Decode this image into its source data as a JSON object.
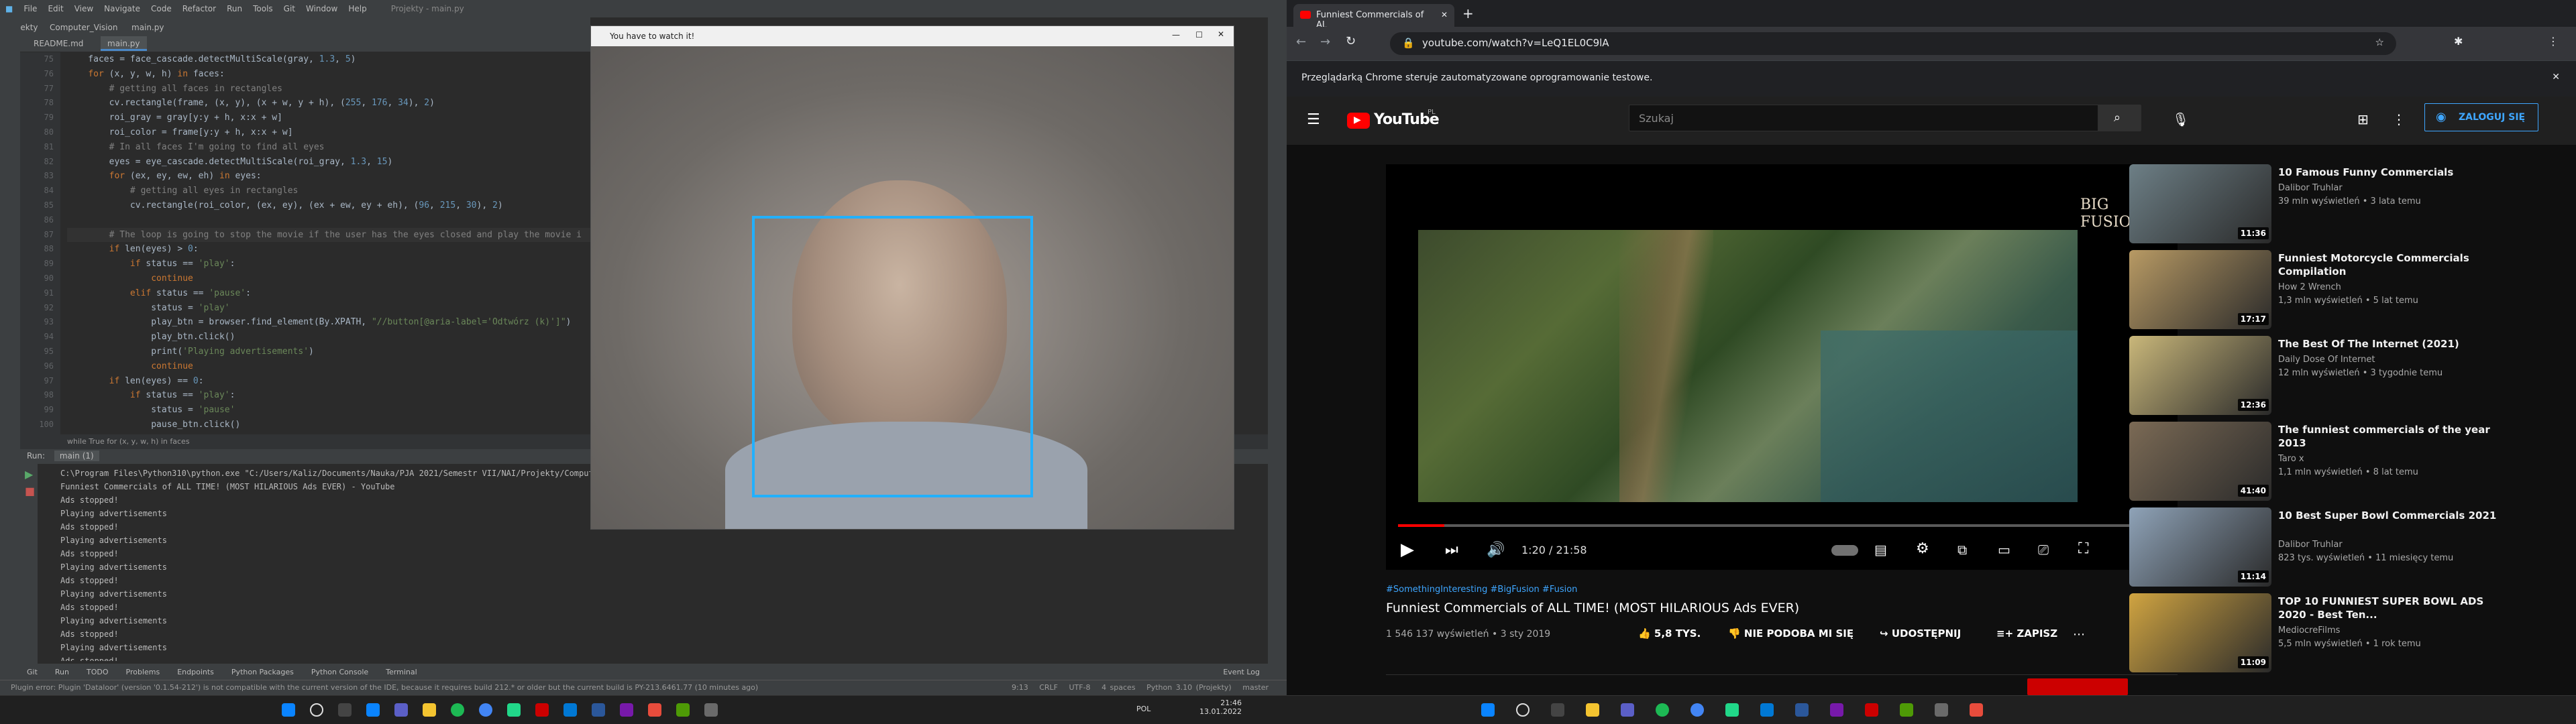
{
  "ide": {
    "menu": [
      "File",
      "Edit",
      "View",
      "Navigate",
      "Code",
      "Refactor",
      "Run",
      "Tools",
      "Git",
      "Window",
      "Help"
    ],
    "window_title": "Projekty - main.py",
    "breadcrumb": [
      "Projekty",
      "Computer_Vision",
      "main.py"
    ],
    "file_tabs": [
      "README.md",
      "main.py"
    ],
    "code_lines": [
      "    faces = face_cascade.detectMultiScale(gray, 1.3, 5)",
      "    for (x, y, w, h) in faces:",
      "        # getting all faces in rectangles",
      "        cv.rectangle(frame, (x, y), (x + w, y + h), (255, 176, 34), 2)",
      "        roi_gray = gray[y:y + h, x:x + w]",
      "        roi_color = frame[y:y + h, x:x + w]",
      "        # In all faces I'm going to find all eyes",
      "        eyes = eye_cascade.detectMultiScale(roi_gray, 1.3, 15)",
      "        for (ex, ey, ew, eh) in eyes:",
      "            # getting all eyes in rectangles",
      "            cv.rectangle(roi_color, (ex, ey), (ex + ew, ey + eh), (96, 215, 30), 2)",
      "",
      "        # The loop is going to stop the movie if the user has the eyes closed and play the movie i",
      "        if len(eyes) > 0:",
      "            if status == 'play':",
      "                continue",
      "            elif status == 'pause':",
      "                status = 'play'",
      "                play_btn = browser.find_element(By.XPATH, \"//button[@aria-label='Odtwórz (k)']\")",
      "                play_btn.click()",
      "                print('Playing advertisements')",
      "                continue",
      "        if len(eyes) == 0:",
      "            if status == 'play':",
      "                status = 'pause'",
      "                pause_btn.click()"
    ],
    "code_crumb": "while True    for (x, y, w, h) in faces",
    "run_tab": "Run:",
    "run_name": "main (1)",
    "run_output": [
      "C:\\Program Files\\Python310\\python.exe \"C:/Users/Kaliz/Documents/Nauka/PJA 2021/Semestr VII/NAI/Projekty/Computer",
      "Funniest Commercials of ALL TIME! (MOST HILARIOUS Ads EVER) - YouTube",
      "Ads stopped!",
      "Playing advertisements",
      "Ads stopped!",
      "Playing advertisements",
      "Ads stopped!",
      "Playing advertisements",
      "Ads stopped!",
      "Playing advertisements",
      "Ads stopped!",
      "Playing advertisements",
      "Ads stopped!",
      "Playing advertisements",
      "Ads stopped!"
    ],
    "bottom_tabs": [
      "Git",
      "Run",
      "TODO",
      "Problems",
      "Endpoints",
      "Python Packages",
      "Python Console",
      "Terminal"
    ],
    "event_log": "Event Log",
    "status_msg": "Plugin error: Plugin 'Dataloor' (version '0.1.54-212') is not compatible with the current version of the IDE, because it requires build 212.* or older but the current build is PY-213.6461.77 (10 minutes ago)",
    "status_right": [
      "9:13",
      "CRLF",
      "UTF-8",
      "4 spaces",
      "Python 3.10 (Projekty)",
      "master"
    ]
  },
  "camera": {
    "title": "You have to watch it!"
  },
  "chrome": {
    "tab_title": "Funniest Commercials of AL",
    "url": "youtube.com/watch?v=LeQ1EL0C9lA",
    "infobar": "Przeglądarką Chrome steruje zautomatyzowane oprogramowanie testowe."
  },
  "youtube": {
    "logo": "YouTube",
    "region": "PL",
    "search_placeholder": "Szukaj",
    "signin": "ZALOGUJ SIĘ",
    "video_brand": "BIG FUSION",
    "time": "1:20 / 21:58",
    "progress": 0.06,
    "hashtags": "#SomethingInteresting #BigFusion #Fusion",
    "title": "Funniest Commercials of ALL TIME! (MOST HILARIOUS Ads EVER)",
    "meta": "1 546 137 wyświetleń • 3 sty 2019",
    "likes": "5,8 TYS.",
    "dislike": "NIE PODOBA MI SIĘ",
    "share": "UDOSTĘPNIJ",
    "save": "ZAPISZ",
    "suggestions": [
      {
        "title": "10 Famous Funny Commercials",
        "channel": "Dalibor Truhlar",
        "meta": "39 mln wyświetleń • 3 lata temu",
        "duration": "11:36",
        "color": "#6d7f86"
      },
      {
        "title": "Funniest Motorcycle Commercials Compilation",
        "channel": "How 2 Wrench",
        "meta": "1,3 mln wyświetleń • 5 lat temu",
        "duration": "17:17",
        "color": "#b89a64"
      },
      {
        "title": "The Best Of The Internet (2021)",
        "channel": "Daily Dose Of Internet",
        "meta": "12 mln wyświetleń • 3 tygodnie temu",
        "duration": "12:36",
        "color": "#c9b77a"
      },
      {
        "title": "The funniest commercials of the year 2013",
        "channel": "Taro x",
        "meta": "1,1 mln wyświetleń • 8 lat temu",
        "duration": "41:40",
        "color": "#7b6a55"
      },
      {
        "title": "10 Best Super Bowl Commercials 2021",
        "channel": "Dalibor Truhlar",
        "meta": "823 tys. wyświetleń • 11 miesięcy temu",
        "duration": "11:14",
        "color": "#8fa3b8"
      },
      {
        "title": "TOP 10 FUNNIEST SUPER BOWL ADS 2020 - Best Ten...",
        "channel": "MediocreFilms",
        "meta": "5,5 mln wyświetleń • 1 rok temu",
        "duration": "11:09",
        "color": "#d0a441"
      }
    ]
  },
  "taskbar_left": {
    "lang": "POL",
    "time": "21:46",
    "date": "13.01.2022"
  }
}
